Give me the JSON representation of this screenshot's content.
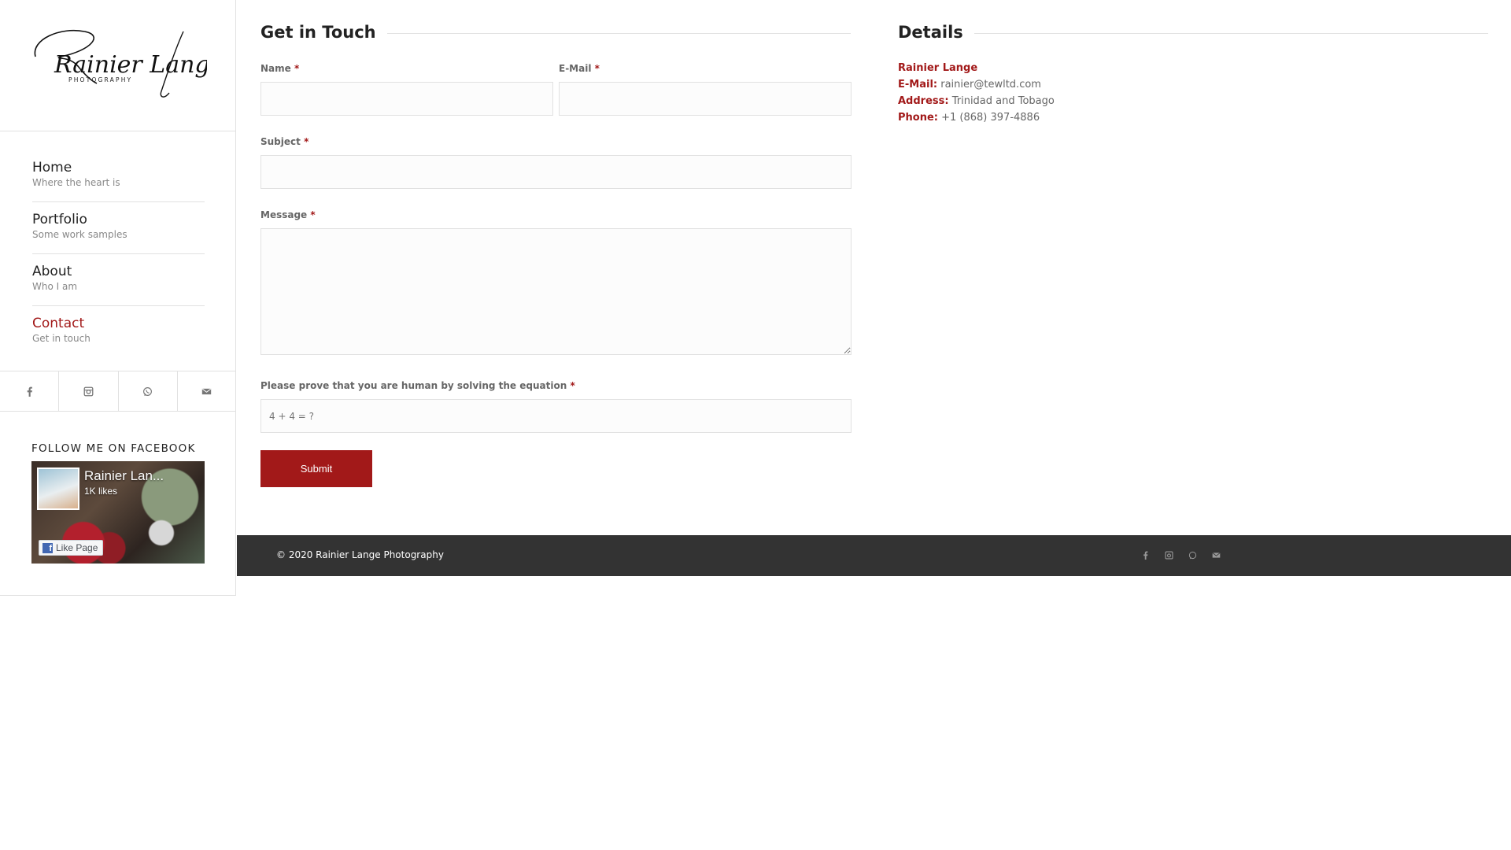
{
  "logo": {
    "script_text": "Rainier Lange",
    "tagline": "PHOTOGRAPHY"
  },
  "nav": {
    "items": [
      {
        "title": "Home",
        "subtitle": "Where the heart is"
      },
      {
        "title": "Portfolio",
        "subtitle": "Some work samples"
      },
      {
        "title": "About",
        "subtitle": "Who I am"
      },
      {
        "title": "Contact",
        "subtitle": "Get in touch"
      }
    ],
    "active_index": 3
  },
  "social": {
    "icons": [
      "facebook-icon",
      "instagram-icon",
      "whatsapp-icon",
      "mail-icon"
    ]
  },
  "facebook_widget": {
    "heading": "FOLLOW ME ON FACEBOOK",
    "page_name": "Rainier Lan...",
    "likes": "1K likes",
    "like_button": "Like Page"
  },
  "contact_form": {
    "title": "Get in Touch",
    "name_label": "Name",
    "email_label": "E-Mail",
    "subject_label": "Subject",
    "message_label": "Message",
    "captcha_label": "Please prove that you are human by solving the equation",
    "required_mark": "*",
    "captcha_placeholder": "4 + 4 = ?",
    "submit_label": "Submit"
  },
  "details": {
    "title": "Details",
    "name": "Rainier Lange",
    "email_label": "E-Mail:",
    "email_value": "rainier@tewltd.com",
    "address_label": "Address:",
    "address_value": "Trinidad and Tobago",
    "phone_label": "Phone:",
    "phone_value": "+1 (868) 397-4886"
  },
  "footer": {
    "copyright": "© 2020 Rainier Lange Photography",
    "icons": [
      "facebook-icon",
      "instagram-icon",
      "whatsapp-icon",
      "mail-icon"
    ]
  },
  "colors": {
    "accent": "#a21919",
    "footer_bg": "#333333",
    "border": "#e1e1e1"
  }
}
